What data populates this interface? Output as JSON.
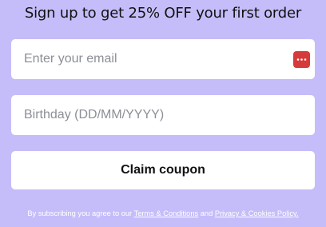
{
  "colors": {
    "background": "#c5bdfa",
    "field_background": "#ffffff",
    "password_manager_icon": "#d63b3b"
  },
  "heading": "Sign up to get 25% OFF your first order",
  "email_field": {
    "placeholder": "Enter your email",
    "value": "",
    "icon": "password-manager-icon"
  },
  "birthday_field": {
    "placeholder": "Birthday (DD/MM/YYYY)",
    "value": ""
  },
  "submit_button": {
    "label": "Claim coupon"
  },
  "disclaimer": {
    "prefix": "By subscribing you agree to our",
    "terms_link": "Terms & Conditions",
    "conjunction": "and",
    "privacy_link": "Privacy & Cookies Policy."
  }
}
